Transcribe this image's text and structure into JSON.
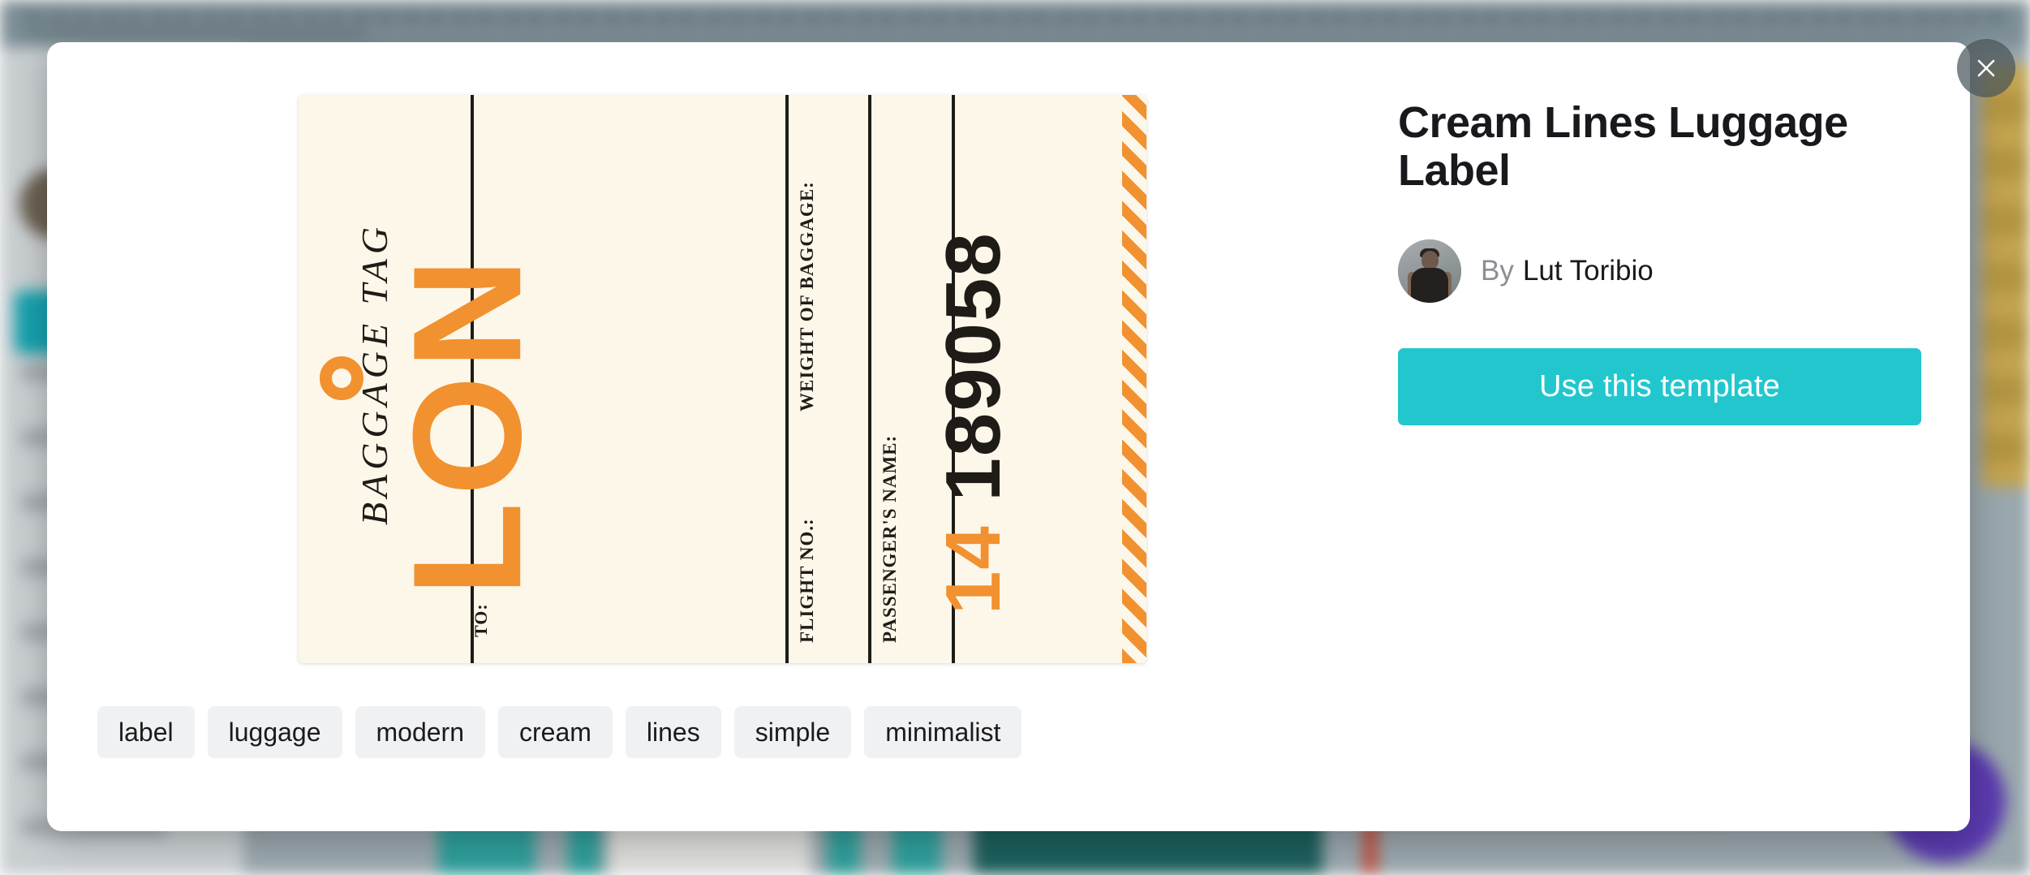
{
  "modal": {
    "close_label": "Close",
    "close_icon": "close-icon"
  },
  "template": {
    "title": "Cream Lines Luggage Label",
    "author": {
      "by_label": "By",
      "name": "Lut Toribio",
      "avatar_icon": "avatar-photo"
    },
    "cta": {
      "label": "Use this template",
      "color": "#22c7ce"
    },
    "tags": [
      "label",
      "luggage",
      "modern",
      "cream",
      "lines",
      "simple",
      "minimalist"
    ],
    "preview": {
      "background_color": "#fdf7ea",
      "accent_color": "#f2912f",
      "ink_color": "#1f1b16",
      "heading": "BAGGAGE TAG",
      "to_label": "TO:",
      "destination_code": "LON",
      "weight_label": "WEIGHT OF BAGGAGE:",
      "flight_label": "FLIGHT NO.:",
      "passenger_label": "PASSENGER'S NAME:",
      "serial_prefix": "14",
      "serial_number": "189058"
    }
  }
}
